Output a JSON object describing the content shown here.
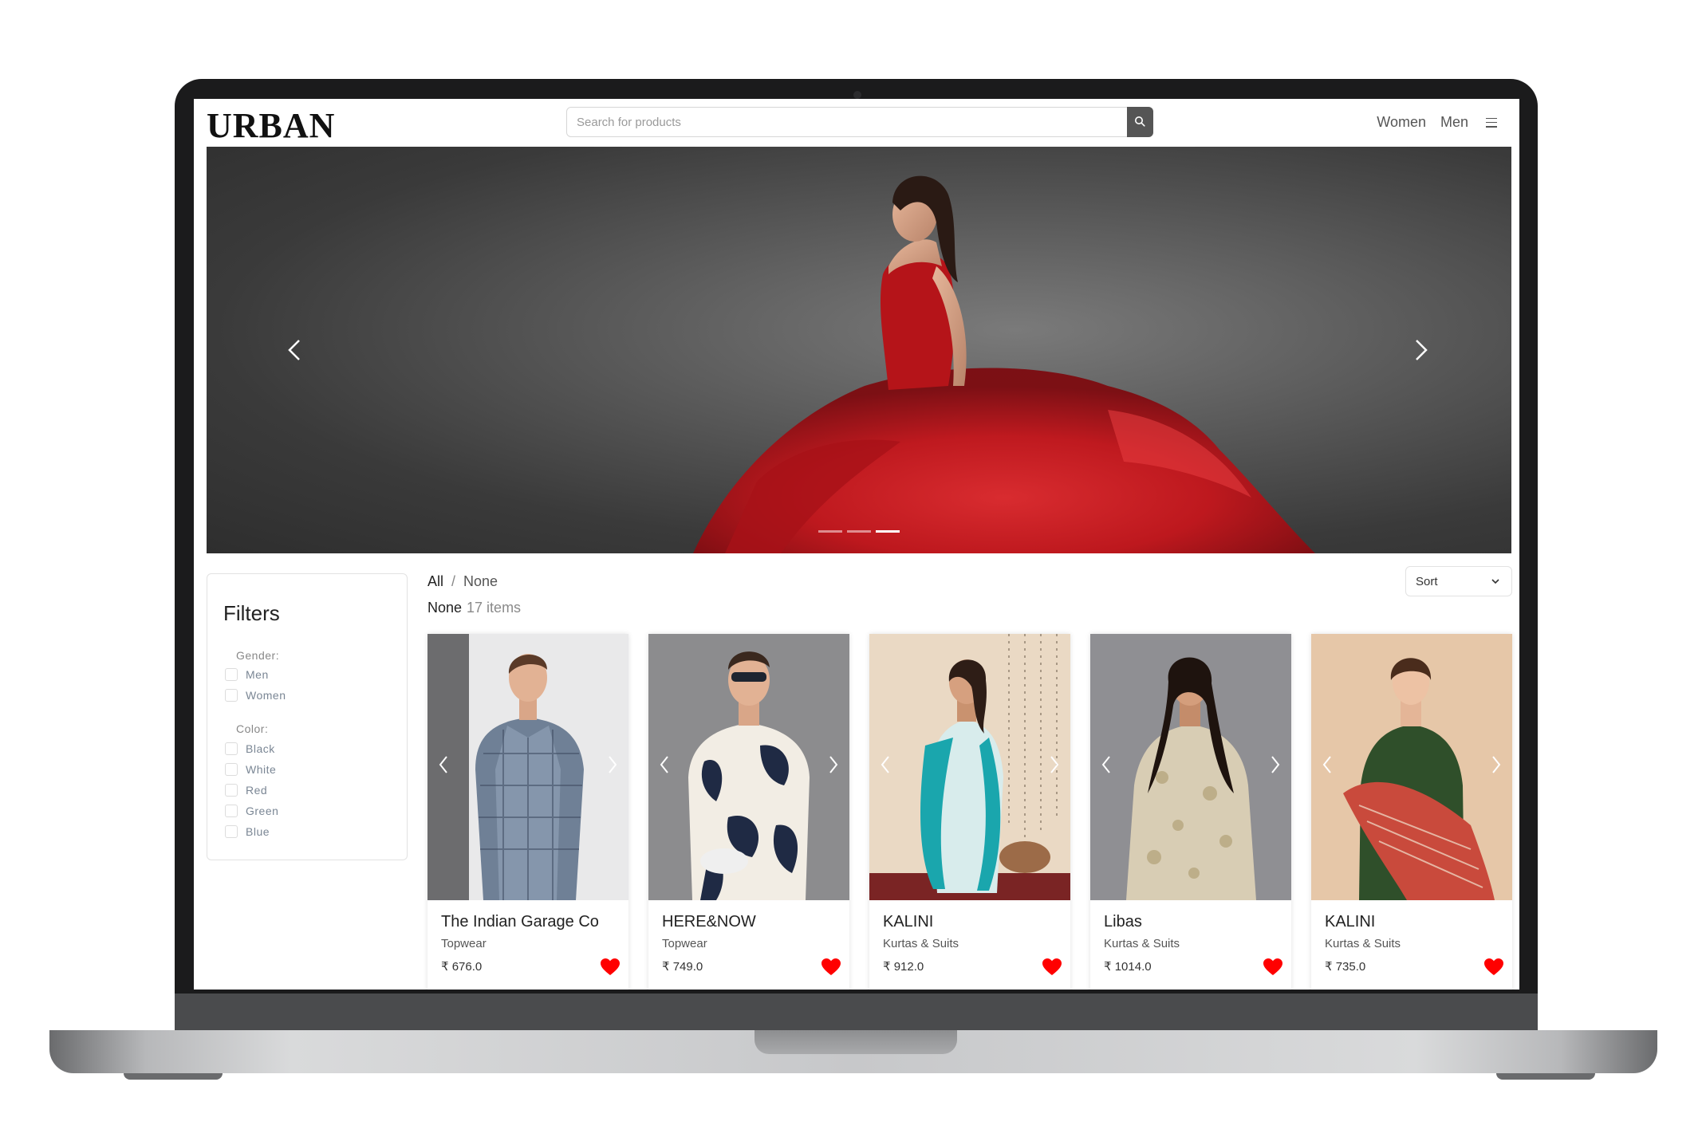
{
  "header": {
    "logo": "URBAN",
    "search_placeholder": "Search for products",
    "nav": [
      "Women",
      "Men"
    ]
  },
  "hero": {
    "slide_count": 3,
    "active_slide": 3
  },
  "filters": {
    "title": "Filters",
    "gender_label": "Gender:",
    "gender_options": [
      "Men",
      "Women"
    ],
    "color_label": "Color:",
    "color_options": [
      "Black",
      "White",
      "Red",
      "Green",
      "Blue"
    ]
  },
  "breadcrumb": {
    "root": "All",
    "separator": "/",
    "current": "None"
  },
  "category": {
    "name": "None",
    "count": "17 items"
  },
  "sort": {
    "label": "Sort"
  },
  "products": [
    {
      "brand": "The Indian Garage Co",
      "category": "Topwear",
      "price": "₹ 676.0"
    },
    {
      "brand": "HERE&NOW",
      "category": "Topwear",
      "price": "₹ 749.0"
    },
    {
      "brand": "KALINI",
      "category": "Kurtas & Suits",
      "price": "₹ 912.0"
    },
    {
      "brand": "Libas",
      "category": "Kurtas & Suits",
      "price": "₹ 1014.0"
    },
    {
      "brand": "KALINI",
      "category": "Kurtas & Suits",
      "price": "₹ 735.0"
    }
  ],
  "colors": {
    "heart": "#ff0000",
    "dress": "#c4161c",
    "search_button": "#555555"
  },
  "icons": [
    "search-icon",
    "hamburger-icon",
    "chevron-left-icon",
    "chevron-right-icon",
    "chevron-down-icon",
    "heart-icon"
  ]
}
